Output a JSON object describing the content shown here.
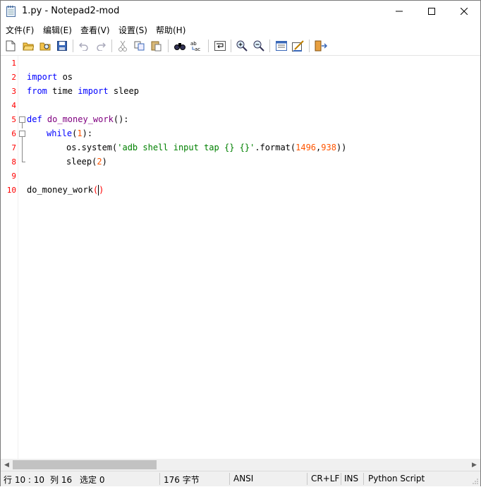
{
  "window": {
    "title": "1.py - Notepad2-mod",
    "minimize_icon": "minimize-icon",
    "maximize_icon": "maximize-icon",
    "close_icon": "close-icon"
  },
  "menu": [
    "文件(F)",
    "编辑(E)",
    "查看(V)",
    "设置(S)",
    "帮助(H)"
  ],
  "toolbar_icons": [
    "new-icon",
    "open-icon",
    "browse-icon",
    "save-icon",
    "undo-icon",
    "redo-icon",
    "cut-icon",
    "copy-icon",
    "paste-icon",
    "find-icon",
    "replace-icon",
    "wordwrap-icon",
    "zoom-in-icon",
    "zoom-out-icon",
    "scheme-icon",
    "customize-icon",
    "exit-icon"
  ],
  "editor": {
    "line_numbers": [
      "1",
      "2",
      "3",
      "4",
      "5",
      "6",
      "7",
      "8",
      "9",
      "10"
    ],
    "lines": {
      "l2": {
        "kw": "import",
        "rest": " os"
      },
      "l3": {
        "kw1": "from",
        "mid": " time ",
        "kw2": "import",
        "rest": " sleep"
      },
      "l5": {
        "kw": "def",
        "fn": " do_money_work",
        "paren": "():"
      },
      "l6": {
        "kw": "while",
        "paren_open": "(",
        "num": "1",
        "paren_close": "):"
      },
      "l7": {
        "pre": "os.system(",
        "str": "'adb shell input tap {} {}'",
        "mid": ".format(",
        "num1": "1496",
        "comma": ",",
        "num2": "938",
        "post": "))"
      },
      "l8": {
        "pre": "sleep(",
        "num": "2",
        "post": ")"
      },
      "l10": {
        "pre": "do_money_work",
        "paren_open": "(",
        "paren_close": ")"
      }
    }
  },
  "status": {
    "position": "行 10 : 10",
    "column": "列 16",
    "selection": "选定 0",
    "size": "176 字节",
    "encoding": "ANSI",
    "line_ending": "CR+LF",
    "insert_mode": "INS",
    "lexer": "Python Script"
  },
  "colors": {
    "keyword": "#0000ff",
    "function": "#800080",
    "number": "#ff5500",
    "string": "#008000",
    "line_number": "#ff0000"
  }
}
